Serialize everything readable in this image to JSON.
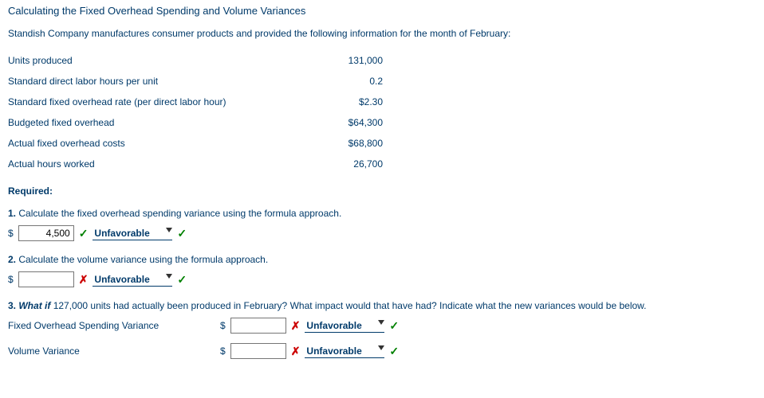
{
  "title": "Calculating the Fixed Overhead Spending and Volume Variances",
  "intro": "Standish Company manufactures consumer products and provided the following information for the month of February:",
  "rows": [
    {
      "label": "Units produced",
      "value": "131,000"
    },
    {
      "label": "Standard direct labor hours per unit",
      "value": "0.2"
    },
    {
      "label": "Standard fixed overhead rate (per direct labor hour)",
      "value": "$2.30"
    },
    {
      "label": "Budgeted fixed overhead",
      "value": "$64,300"
    },
    {
      "label": "Actual fixed overhead costs",
      "value": "$68,800"
    },
    {
      "label": "Actual hours worked",
      "value": "26,700"
    }
  ],
  "required": "Required:",
  "q1": {
    "num": "1.",
    "text": " Calculate the fixed overhead spending variance using the formula approach.",
    "dollar": "$",
    "value": "4,500",
    "select": "Unfavorable"
  },
  "q2": {
    "num": "2.",
    "text": " Calculate the volume variance using the formula approach.",
    "dollar": "$",
    "value": "",
    "select": "Unfavorable"
  },
  "q3": {
    "num": "3.",
    "whatif": "What if",
    "text": " 127,000 units had actually been produced in February? What impact would that have had? Indicate what the new variances would be below.",
    "rows": [
      {
        "label": "Fixed Overhead Spending Variance",
        "dollar": "$",
        "value": "",
        "select": "Unfavorable"
      },
      {
        "label": "Volume Variance",
        "dollar": "$",
        "value": "",
        "select": "Unfavorable"
      }
    ]
  }
}
